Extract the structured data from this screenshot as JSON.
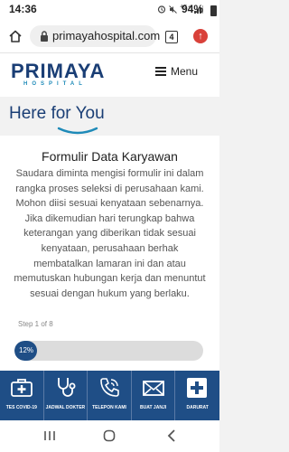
{
  "status_bar": {
    "time": "14:36",
    "network": "4G+",
    "battery": "94%"
  },
  "browser": {
    "url": "primayahospital.com",
    "tab_count": "4",
    "home_icon": "home-icon",
    "lock_icon": "lock-icon"
  },
  "site_header": {
    "logo_main": "PRIMAYA",
    "logo_sub": "HOSPITAL",
    "menu_label": "Menu"
  },
  "tagline": "Here for You",
  "form": {
    "title": "Formulir Data Karyawan",
    "intro": "Saudara diminta mengisi formulir ini dalam rangka proses seleksi di perusahaan kami. Mohon diisi sesuai kenyataan sebenarnya. Jika dikemudian hari terungkap bahwa keterangan yang diberikan tidak sesuai kenyataan, perusahaan berhak membatalkan lamaran ini dan atau memutuskan hubungan kerja dan menuntut sesuai dengan hukum yang berlaku.",
    "step_label": "Step 1 of 8",
    "progress_label": "12%",
    "progress_fraction": 0.12
  },
  "bottom_nav": [
    {
      "label": "TES COVID-19",
      "icon": "medical-kit-icon"
    },
    {
      "label": "JADWAL DOKTER",
      "icon": "stethoscope-icon"
    },
    {
      "label": "TELEPON KAMI",
      "icon": "phone-icon"
    },
    {
      "label": "BUAT JANJI",
      "icon": "envelope-icon"
    },
    {
      "label": "DARURAT",
      "icon": "emergency-cross-icon"
    }
  ],
  "colors": {
    "brand_navy": "#1a3e75",
    "nav_blue": "#1f4e86",
    "accent_cyan": "#1e8ab8",
    "alert_red": "#d9413a"
  }
}
